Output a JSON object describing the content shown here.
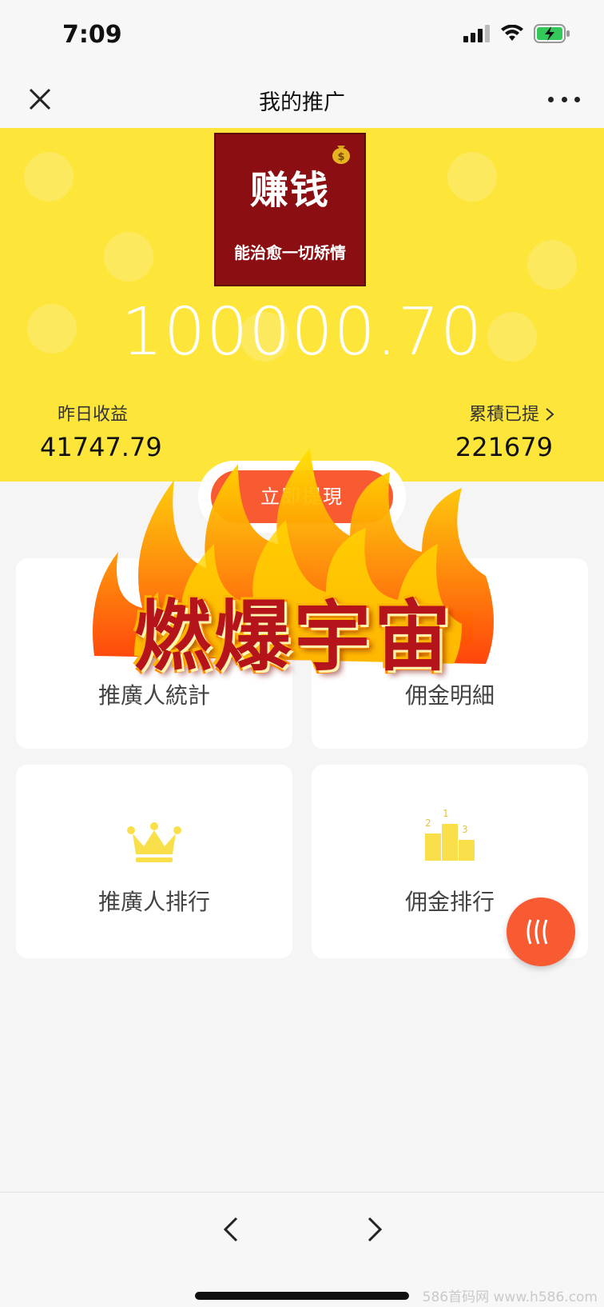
{
  "status_bar": {
    "time": "7:09",
    "icons": [
      "signal-icon",
      "wifi-icon",
      "battery-charging-icon"
    ]
  },
  "nav": {
    "title": "我的推广",
    "close_icon": "close-icon",
    "more_icon": "more-icon"
  },
  "banner": {
    "background_color": "#fde53a",
    "promo_title": "赚钱",
    "promo_subtitle": "能治愈一切矫情",
    "balance": "100000.70",
    "yesterday_label": "昨日收益",
    "yesterday_value": "41747.79",
    "withdrawn_label": "累積已提",
    "withdrawn_value": "221679"
  },
  "withdraw_button": {
    "label": "立即提現",
    "color": "#f85a32"
  },
  "overlay_text": "燃爆宇宙",
  "grid": [
    {
      "label": "推廣人統計",
      "icon": "people-icon"
    },
    {
      "label": "佣金明細",
      "icon": "money-icon"
    },
    {
      "label": "推廣人排行",
      "icon": "crown-icon"
    },
    {
      "label": "佣金排行",
      "icon": "podium-icon"
    }
  ],
  "podium_numbers": [
    "2",
    "1",
    "3"
  ],
  "accent_yellow": "#f9e04a",
  "toolbar": {
    "back_icon": "chevron-left-icon",
    "forward_icon": "chevron-right-icon"
  },
  "watermark": "586首码网 www.h586.com"
}
